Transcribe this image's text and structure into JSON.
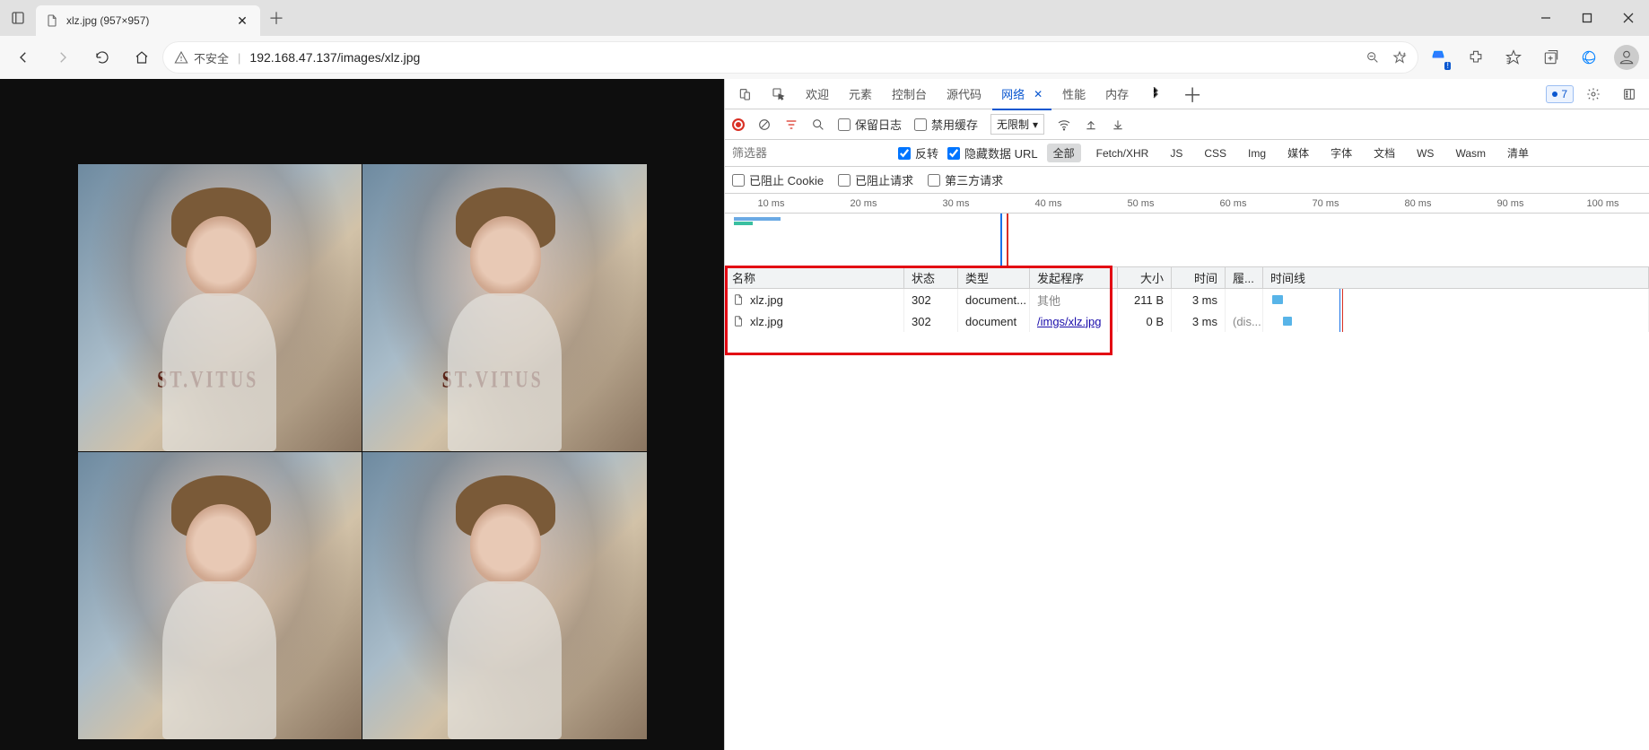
{
  "titlebar": {
    "tab_title": "xlz.jpg (957×957)"
  },
  "addressbar": {
    "insecure_label": "不安全",
    "url": "192.168.47.137/images/xlz.jpg"
  },
  "image": {
    "shirt_text": "ST.VITUS"
  },
  "devtools": {
    "tabs": {
      "welcome": "欢迎",
      "elements": "元素",
      "console": "控制台",
      "sources": "源代码",
      "network": "网络",
      "performance": "性能",
      "memory": "内存"
    },
    "issues_count": "7",
    "toolbar": {
      "preserve_log": "保留日志",
      "disable_cache": "禁用缓存",
      "throttle": "无限制"
    },
    "filters": {
      "placeholder": "筛选器",
      "invert": "反转",
      "hide_data_url": "隐藏数据 URL",
      "all": "全部",
      "fetch": "Fetch/XHR",
      "js": "JS",
      "css": "CSS",
      "img": "Img",
      "media": "媒体",
      "font": "字体",
      "doc": "文档",
      "ws": "WS",
      "wasm": "Wasm",
      "manifest": "清单"
    },
    "blocked": {
      "cookies": "已阻止 Cookie",
      "requests": "已阻止请求",
      "third_party": "第三方请求"
    },
    "timeline_ticks": [
      "10 ms",
      "20 ms",
      "30 ms",
      "40 ms",
      "50 ms",
      "60 ms",
      "70 ms",
      "80 ms",
      "90 ms",
      "100 ms"
    ],
    "table_headers": {
      "name": "名称",
      "status": "状态",
      "type": "类型",
      "initiator": "发起程序",
      "size": "大小",
      "time": "时间",
      "fulfilled": "履...",
      "waterfall": "时间线"
    },
    "rows": [
      {
        "name": "xlz.jpg",
        "status": "302",
        "type": "document...",
        "initiator": "其他",
        "initiator_link": false,
        "size": "211 B",
        "time": "3 ms",
        "fulfilled": ""
      },
      {
        "name": "xlz.jpg",
        "status": "302",
        "type": "document",
        "initiator": "/imgs/xlz.jpg",
        "initiator_link": true,
        "size": "0 B",
        "time": "3 ms",
        "fulfilled": "(dis..."
      }
    ]
  }
}
